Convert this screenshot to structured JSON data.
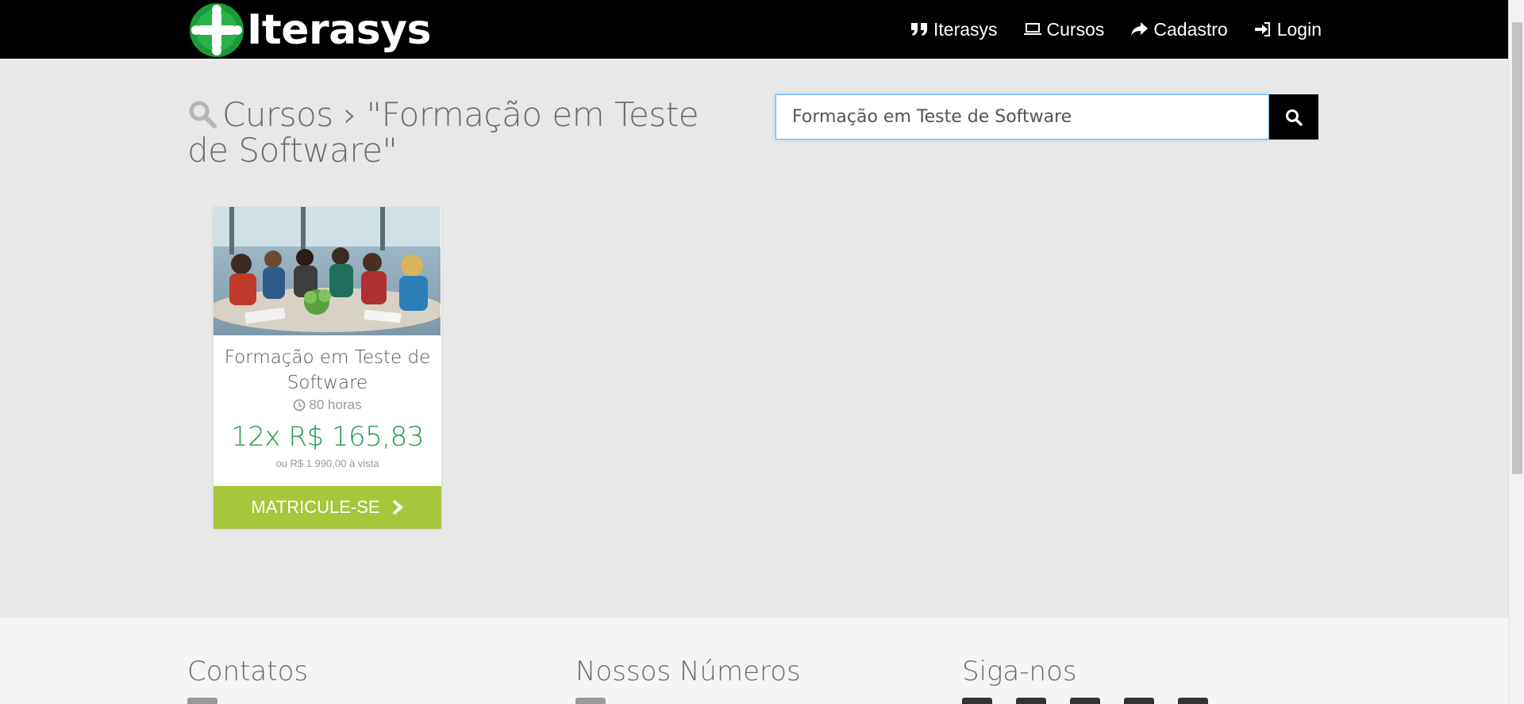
{
  "header": {
    "logo_text": "Iterasys",
    "nav": [
      {
        "label": "Iterasys",
        "icon": "quote-icon"
      },
      {
        "label": "Cursos",
        "icon": "laptop-icon"
      },
      {
        "label": "Cadastro",
        "icon": "share-icon"
      },
      {
        "label": "Login",
        "icon": "sign-in-icon"
      }
    ]
  },
  "main": {
    "title": "Cursos › \"Formação em Teste de Software\"",
    "search": {
      "value": "Formação em Teste de Software",
      "button_icon": "search-icon"
    }
  },
  "course": {
    "title": "Formação em Teste de Software",
    "hours": "80 horas",
    "price_installments": "12x R$ 165,83",
    "price_cash": "ou R$ 1.990,00 à vista",
    "cta_label": "MATRICULE-SE"
  },
  "footer": {
    "columns": [
      "Contatos",
      "Nossos Números",
      "Siga-nos"
    ]
  },
  "colors": {
    "header_bg": "#000000",
    "price_green": "#1e9a52",
    "cta_green": "#a6c63b",
    "page_bg": "#e8e8e8"
  }
}
